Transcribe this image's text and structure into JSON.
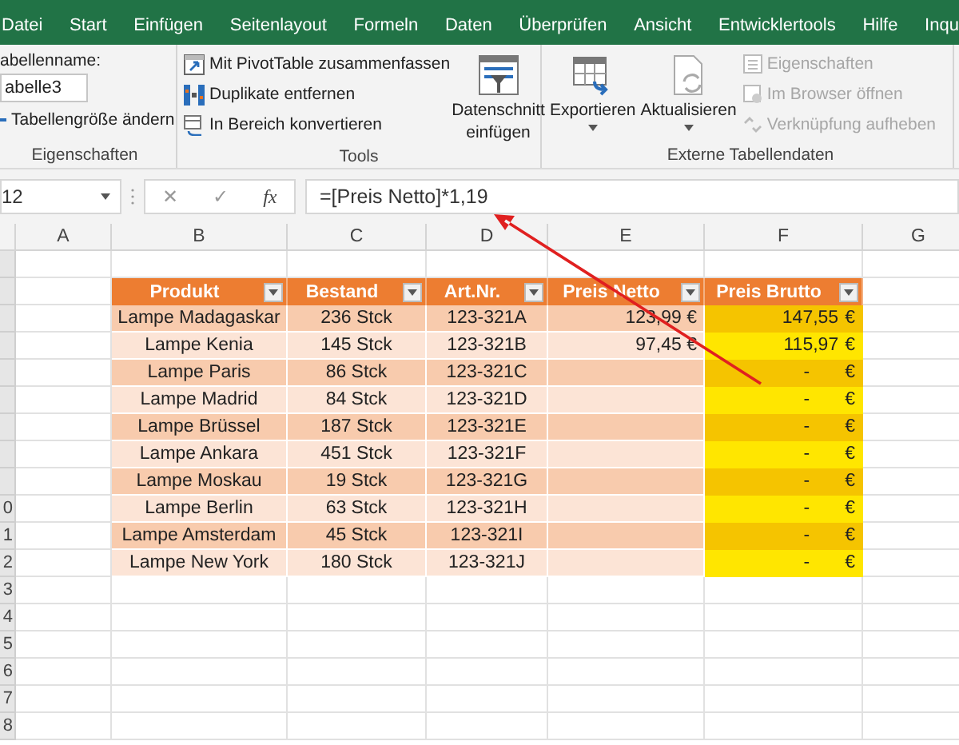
{
  "menu_tabs": [
    "Datei",
    "Start",
    "Einfügen",
    "Seitenlayout",
    "Formeln",
    "Daten",
    "Überprüfen",
    "Ansicht",
    "Entwicklertools",
    "Hilfe",
    "Inqu"
  ],
  "ribbon": {
    "groups": [
      {
        "kind": "properties",
        "label": "Eigenschaften",
        "name_label": "abellenname:",
        "name_value": "abelle3",
        "resize": "Tabellengröße ändern"
      },
      {
        "kind": "tools",
        "label": "Tools",
        "buttons": [
          {
            "label": "Mit PivotTable zusammenfassen"
          },
          {
            "label": "Duplikate entfernen"
          },
          {
            "label": "In Bereich konvertieren"
          }
        ],
        "big": {
          "label": "Datenschnitt einfügen"
        }
      },
      {
        "kind": "external",
        "label": "Externe Tabellendaten",
        "big": [
          {
            "label": "Exportieren"
          },
          {
            "label": "Aktualisieren"
          }
        ],
        "buttons": [
          {
            "label": "Eigenschaften",
            "disabled": true
          },
          {
            "label": "Im Browser öffnen",
            "disabled": true
          },
          {
            "label": "Verknüpfung aufheben",
            "disabled": true
          }
        ]
      }
    ]
  },
  "formula_bar": {
    "name_box": "12",
    "cancel": "✕",
    "enter": "✓",
    "fx": "fx",
    "formula": "=[Preis Netto]*1,19"
  },
  "sheet": {
    "columns": [
      "A",
      "B",
      "C",
      "D",
      "E",
      "F",
      "G"
    ],
    "row_numbers": [
      "0",
      "1",
      "2",
      "3",
      "4",
      "5",
      "6",
      "7",
      "8"
    ],
    "table": {
      "headers": [
        "Produkt",
        "Bestand",
        "Art.Nr.",
        "Preis Netto",
        "Preis Brutto"
      ],
      "rows": [
        {
          "product": "Lampe Madagaskar",
          "stock": "236 Stck",
          "number": "123-321A",
          "net": "123,99 €",
          "gross": {
            "kind": "value",
            "amount": "147,55",
            "currency": "€"
          }
        },
        {
          "product": "Lampe Kenia",
          "stock": "145 Stck",
          "number": "123-321B",
          "net": "97,45 €",
          "gross": {
            "kind": "value",
            "amount": "115,97",
            "currency": "€"
          }
        },
        {
          "product": "Lampe Paris",
          "stock": "86 Stck",
          "number": "123-321C",
          "net": null,
          "gross": {
            "kind": "zero",
            "amount": "-",
            "currency": "€"
          }
        },
        {
          "product": "Lampe Madrid",
          "stock": "84 Stck",
          "number": "123-321D",
          "net": null,
          "gross": {
            "kind": "zero",
            "amount": "-",
            "currency": "€"
          }
        },
        {
          "product": "Lampe Brüssel",
          "stock": "187 Stck",
          "number": "123-321E",
          "net": null,
          "gross": {
            "kind": "zero",
            "amount": "-",
            "currency": "€"
          }
        },
        {
          "product": "Lampe Ankara",
          "stock": "451 Stck",
          "number": "123-321F",
          "net": null,
          "gross": {
            "kind": "zero",
            "amount": "-",
            "currency": "€"
          }
        },
        {
          "product": "Lampe Moskau",
          "stock": "19 Stck",
          "number": "123-321G",
          "net": null,
          "gross": {
            "kind": "zero",
            "amount": "-",
            "currency": "€"
          }
        },
        {
          "product": "Lampe Berlin",
          "stock": "63 Stck",
          "number": "123-321H",
          "net": null,
          "gross": {
            "kind": "zero",
            "amount": "-",
            "currency": "€"
          }
        },
        {
          "product": "Lampe Amsterdam",
          "stock": "45 Stck",
          "number": "123-321I",
          "net": null,
          "gross": {
            "kind": "zero",
            "amount": "-",
            "currency": "€"
          }
        },
        {
          "product": "Lampe New York",
          "stock": "180 Stck",
          "number": "123-321J",
          "net": null,
          "gross": {
            "kind": "zero",
            "amount": "-",
            "currency": "€"
          }
        }
      ]
    }
  }
}
